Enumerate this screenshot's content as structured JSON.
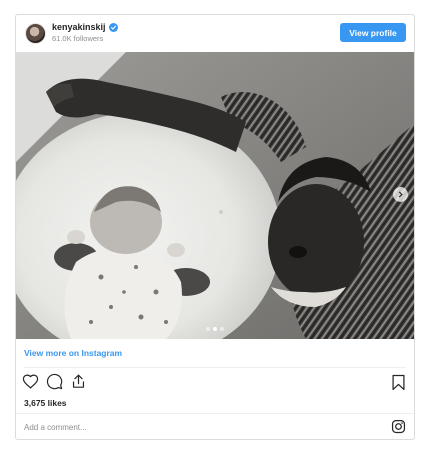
{
  "header": {
    "username": "kenyakinskij",
    "followers": "61.0K followers",
    "view_profile_label": "View profile",
    "verified_icon": "verified-badge-icon",
    "avatar_icon": "profile-avatar"
  },
  "photo": {
    "description_icon": "post-photo",
    "carousel_dots": 3,
    "active_dot": 2
  },
  "view_more_label": "View more on Instagram",
  "actions": {
    "like_icon": "heart-icon",
    "comment_icon": "comment-icon",
    "share_icon": "share-icon",
    "save_icon": "bookmark-icon"
  },
  "likes": "3,675 likes",
  "comment": {
    "placeholder": "Add a comment...",
    "instagram_icon": "instagram-icon"
  },
  "colors": {
    "accent": "#3897f0",
    "text": "#262626",
    "muted": "#8e8e8e",
    "border": "#dbdbdb"
  }
}
